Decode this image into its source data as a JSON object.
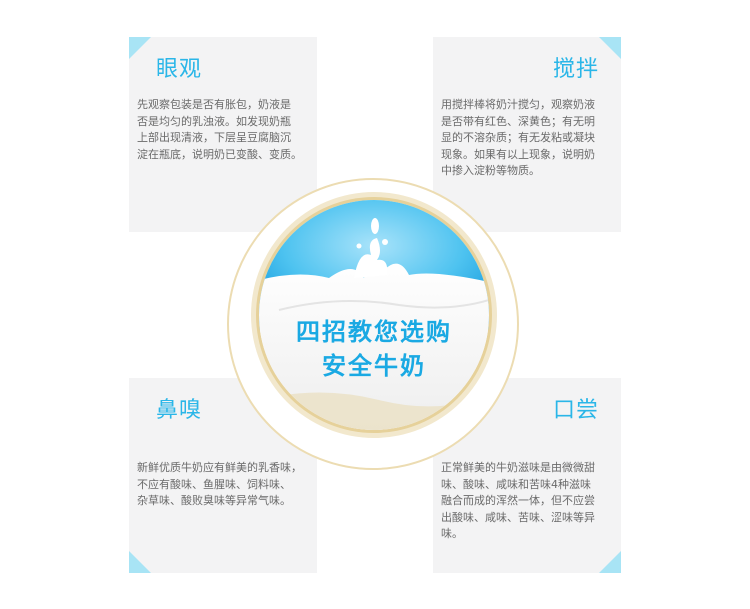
{
  "cards": {
    "look": {
      "title": "眼观",
      "lines": [
        "先观察包装是否有胀包，奶液是",
        "否是均匀的乳浊液。如发现奶瓶",
        "上部出现清液，下层呈豆腐脑沉",
        "淀在瓶底，说明奶已变酸、变质。"
      ]
    },
    "stir": {
      "title": "搅拌",
      "lines": [
        "用搅拌棒将奶汁搅匀，观察奶液",
        "是否带有红色、深黄色；有无明",
        "显的不溶杂质；有无发粘或凝块",
        "现象。如果有以上现象，说明奶",
        "中掺入淀粉等物质。"
      ]
    },
    "smell": {
      "title": "鼻嗅",
      "lines": [
        "新鲜优质牛奶应有鲜美的乳香味，",
        "不应有酸味、鱼腥味、饲料味、",
        "杂草味、酸败臭味等异常气味。"
      ]
    },
    "taste": {
      "title": "口尝",
      "lines": [
        "正常鲜美的牛奶滋味是由微微甜",
        "味、酸味、咸味和苦味4种滋味",
        "融合而成的浑然一体，但不应尝",
        "出酸味、咸味、苦味、涩味等异",
        "味。"
      ]
    }
  },
  "center": {
    "line1": "四招教您选购",
    "line2": "安全牛奶"
  },
  "colors": {
    "accent": "#2ab6e8",
    "corner": "#a8e4f5",
    "card_bg": "#f3f3f4",
    "gold": "#e6d19a"
  },
  "icons": {
    "center_image": "milk-splash-illustration"
  }
}
